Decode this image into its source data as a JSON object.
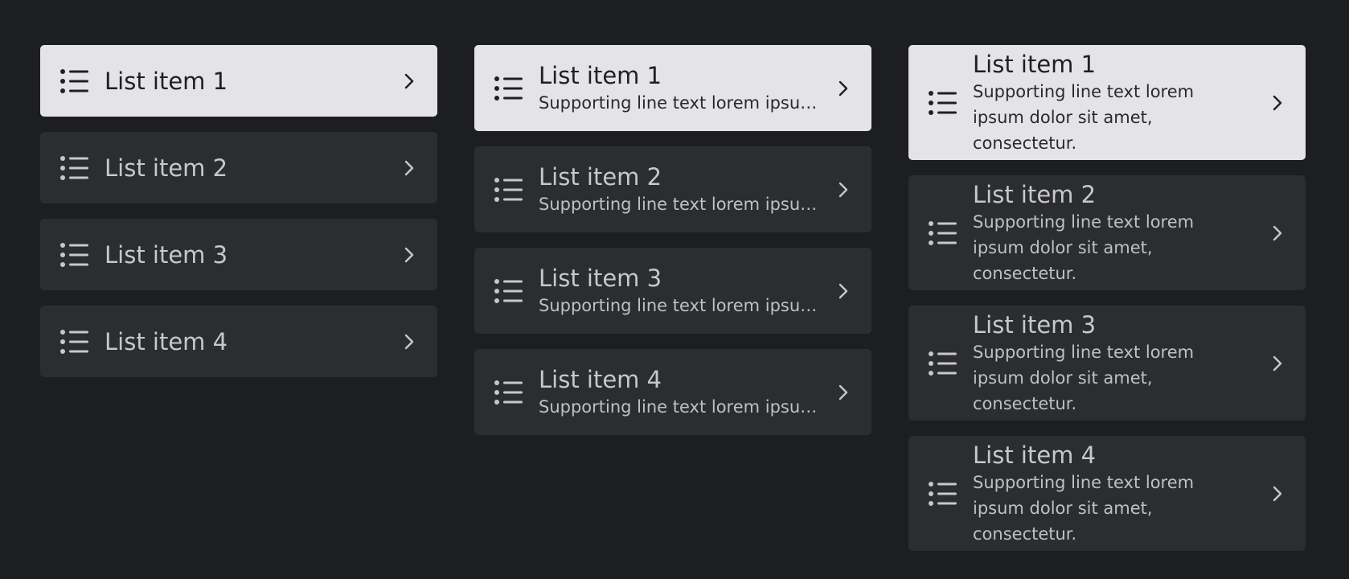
{
  "columns": [
    {
      "variant": "one-line",
      "items": [
        {
          "headline": "List item 1",
          "selected": true,
          "icon": "list-icon",
          "trailing_icon": "chevron-right-icon"
        },
        {
          "headline": "List item 2",
          "selected": false,
          "icon": "list-icon",
          "trailing_icon": "chevron-right-icon"
        },
        {
          "headline": "List item 3",
          "selected": false,
          "icon": "list-icon",
          "trailing_icon": "chevron-right-icon"
        },
        {
          "headline": "List item 4",
          "selected": false,
          "icon": "list-icon",
          "trailing_icon": "chevron-right-icon"
        }
      ]
    },
    {
      "variant": "two-line",
      "items": [
        {
          "headline": "List item 1",
          "supporting": "Supporting line text lorem ipsum dolor sit amet, consectetur.",
          "selected": true,
          "icon": "list-icon",
          "trailing_icon": "chevron-right-icon"
        },
        {
          "headline": "List item 2",
          "supporting": "Supporting line text lorem ipsum dolor sit amet, consectetur.",
          "selected": false,
          "icon": "list-icon",
          "trailing_icon": "chevron-right-icon"
        },
        {
          "headline": "List item 3",
          "supporting": "Supporting line text lorem ipsum dolor sit amet, consectetur.",
          "selected": false,
          "icon": "list-icon",
          "trailing_icon": "chevron-right-icon"
        },
        {
          "headline": "List item 4",
          "supporting": "Supporting line text lorem ipsum dolor sit amet, consectetur.",
          "selected": false,
          "icon": "list-icon",
          "trailing_icon": "chevron-right-icon"
        }
      ]
    },
    {
      "variant": "three-line",
      "items": [
        {
          "headline": "List item 1",
          "supporting": "Supporting line text lorem ipsum dolor sit amet, consectetur.",
          "selected": true,
          "icon": "list-icon",
          "trailing_icon": "chevron-right-icon"
        },
        {
          "headline": "List item 2",
          "supporting": "Supporting line text lorem ipsum dolor sit amet, consectetur.",
          "selected": false,
          "icon": "list-icon",
          "trailing_icon": "chevron-right-icon"
        },
        {
          "headline": "List item 3",
          "supporting": "Supporting line text lorem ipsum dolor sit amet, consectetur.",
          "selected": false,
          "icon": "list-icon",
          "trailing_icon": "chevron-right-icon"
        },
        {
          "headline": "List item 4",
          "supporting": "Supporting line text lorem ipsum dolor sit amet, consectetur.",
          "selected": false,
          "icon": "list-icon",
          "trailing_icon": "chevron-right-icon"
        }
      ]
    }
  ],
  "colors": {
    "background": "#1d1e20",
    "item_background": "#2c2d30",
    "selected_background": "#e3e3e8",
    "text": "#c7c8cc",
    "selected_text": "#1f2024"
  }
}
